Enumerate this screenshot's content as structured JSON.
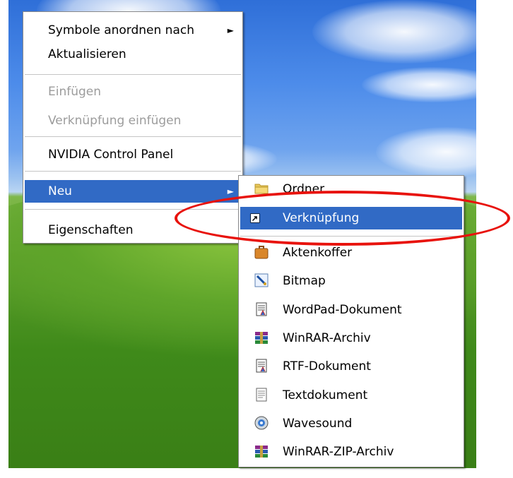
{
  "context_menu": {
    "items": [
      {
        "label": "Symbole anordnen nach",
        "submenu": true
      },
      {
        "label": "Aktualisieren"
      },
      {
        "label": "Einfügen",
        "disabled": true
      },
      {
        "label": "Verknüpfung einfügen",
        "disabled": true
      },
      {
        "label": "NVIDIA Control Panel"
      },
      {
        "label": "Neu",
        "submenu": true,
        "highlighted": true
      },
      {
        "label": "Eigenschaften"
      }
    ],
    "arrow_glyph": "►"
  },
  "new_submenu": {
    "items": [
      {
        "label": "Ordner",
        "icon": "folder-icon"
      },
      {
        "label": "Verknüpfung",
        "icon": "shortcut-icon",
        "highlighted": true
      },
      {
        "label": "Aktenkoffer",
        "icon": "briefcase-icon"
      },
      {
        "label": "Bitmap",
        "icon": "paint-icon"
      },
      {
        "label": "WordPad-Dokument",
        "icon": "wordpad-document-icon"
      },
      {
        "label": "WinRAR-Archiv",
        "icon": "winrar-icon"
      },
      {
        "label": "RTF-Dokument",
        "icon": "rtf-document-icon"
      },
      {
        "label": "Textdokument",
        "icon": "text-document-icon"
      },
      {
        "label": "Wavesound",
        "icon": "audio-icon"
      },
      {
        "label": "WinRAR-ZIP-Archiv",
        "icon": "winrar-zip-icon"
      }
    ]
  },
  "colors": {
    "highlight": "#316ac5",
    "annotation": "#e8120c"
  }
}
